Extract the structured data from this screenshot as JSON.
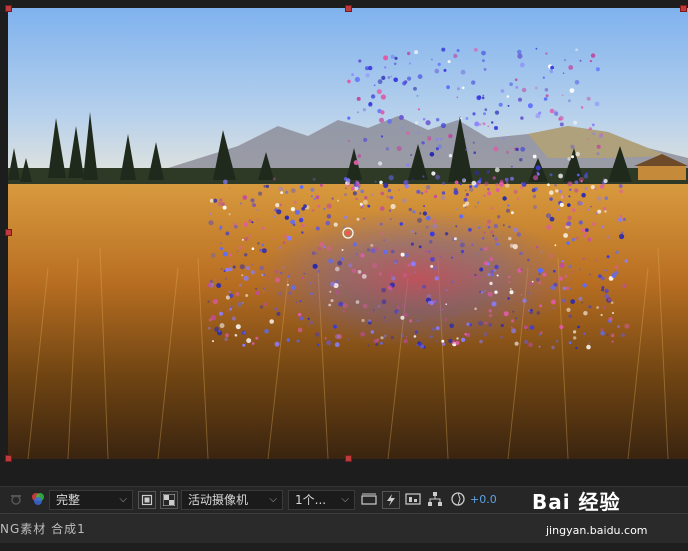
{
  "viewer": {
    "resolution": "完整",
    "camera": "活动摄像机",
    "views": "1个...",
    "exposure": "+0.0"
  },
  "panel": {
    "tab_text": "NG素材 合成1"
  },
  "watermark": {
    "logo": "Bai 经验",
    "url": "jingyan.baidu.com"
  },
  "colors": {
    "accent": "#5aa3e6",
    "handle": "#c0393b"
  }
}
